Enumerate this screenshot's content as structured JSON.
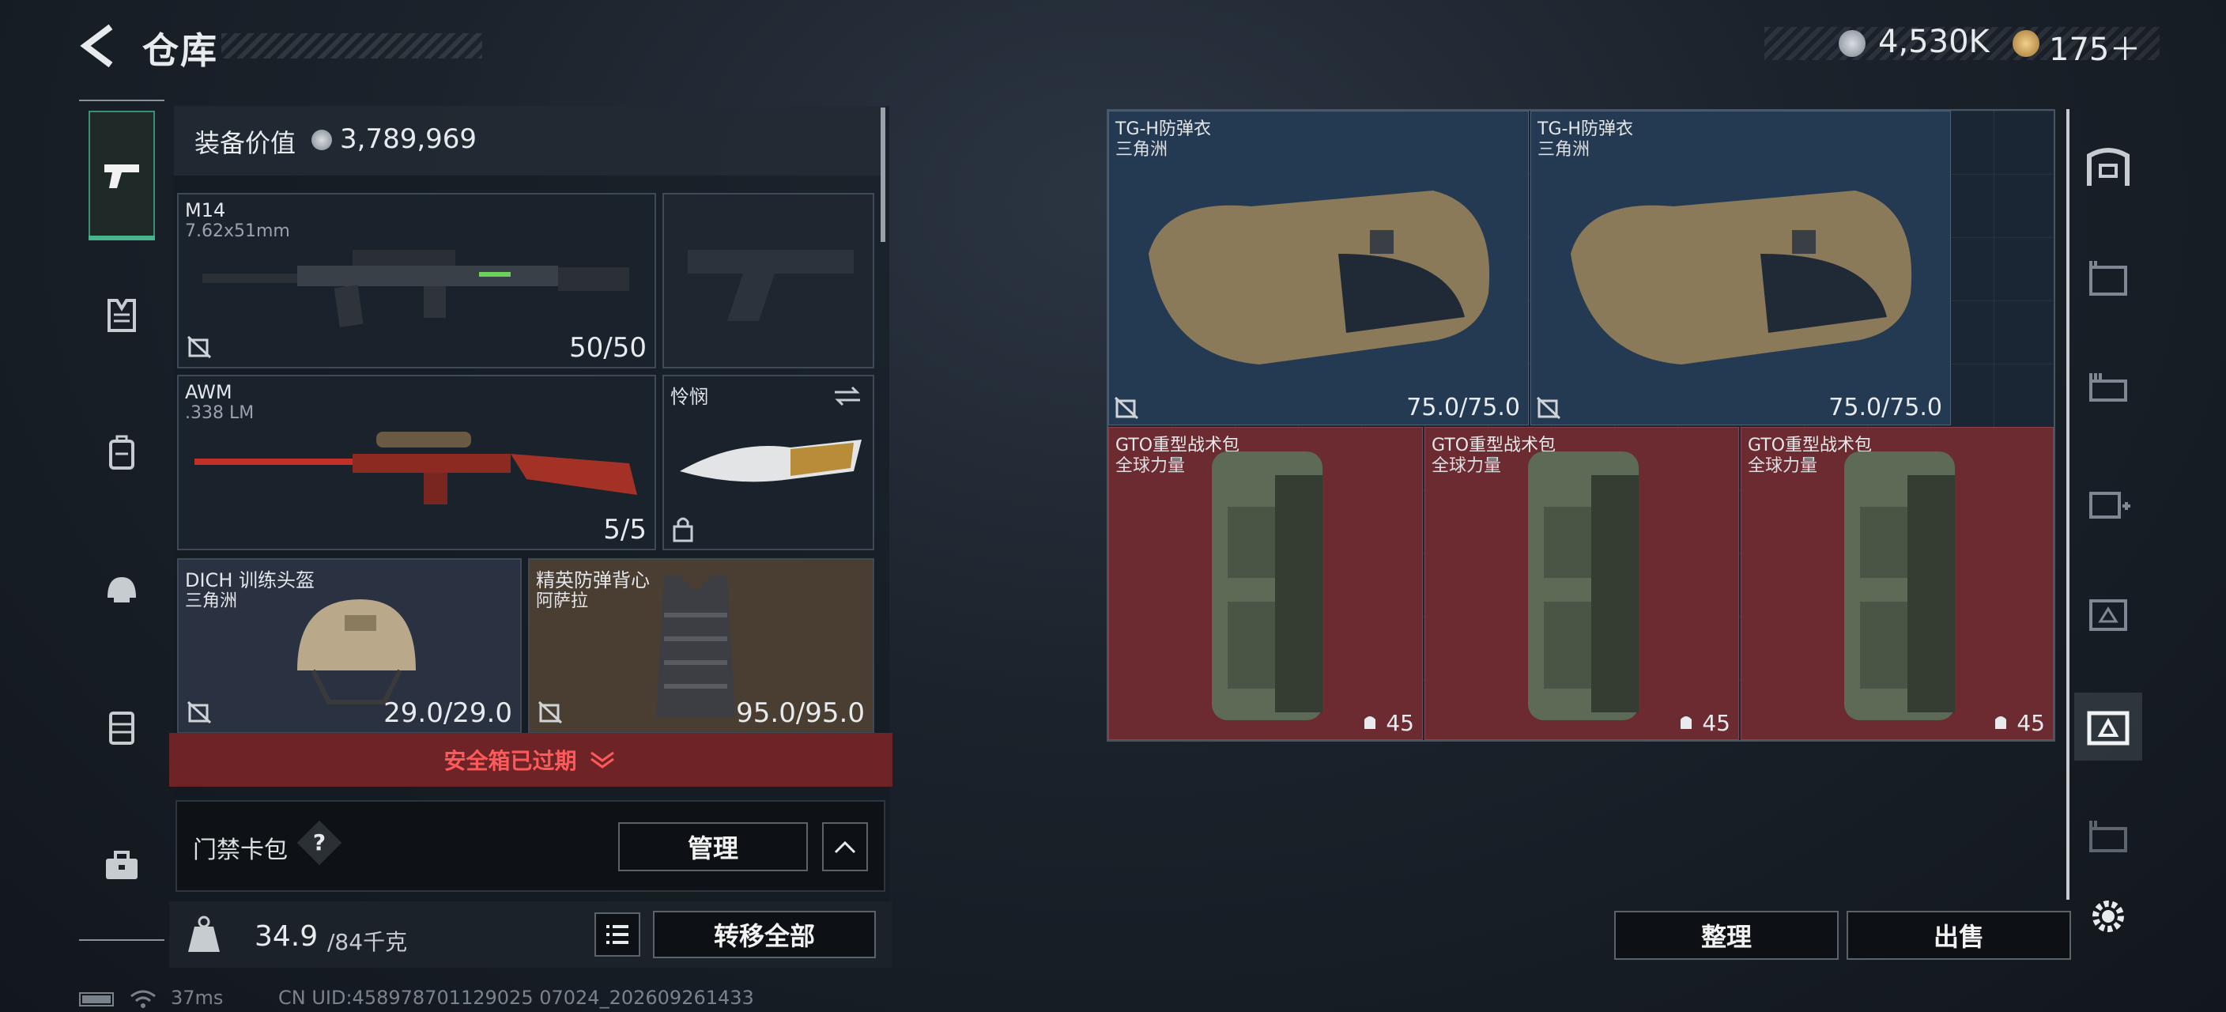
{
  "header": {
    "title": "仓库",
    "currency_1": "4,530K",
    "currency_2": "175＋"
  },
  "side_nav": {
    "items": [
      "pistol-icon",
      "vest-icon",
      "backpack-icon",
      "helmet-icon",
      "chest-rig-icon",
      "toolbox-icon"
    ],
    "active": 0
  },
  "loadout": {
    "value_label": "装备价值",
    "value": "3,789,969",
    "primary": {
      "name": "M14",
      "ammo": "7.62x51mm",
      "durability": "50/50"
    },
    "secondary": {
      "name": "AWM",
      "ammo": ".338 LM",
      "durability": "5/5"
    },
    "melee": {
      "name": "怜悯"
    },
    "helmet": {
      "name": "DICH 训练头盔",
      "origin": "三角洲",
      "durability": "29.0/29.0"
    },
    "armor": {
      "name": "精英防弹背心",
      "origin": "阿萨拉",
      "durability": "95.0/95.0"
    },
    "safe_box_status": "安全箱已过期",
    "keycard": {
      "label": "门禁卡包",
      "help": "?",
      "manage": "管理"
    },
    "weight": {
      "current": "34.9",
      "max": "/84千克"
    },
    "transfer_all": "转移全部"
  },
  "storage": {
    "vests": [
      {
        "name": "TG-H防弹衣",
        "origin": "三角洲",
        "durability": "75.0/75.0"
      },
      {
        "name": "TG-H防弹衣",
        "origin": "三角洲",
        "durability": "75.0/75.0"
      }
    ],
    "bags": [
      {
        "name": "GTO重型战术包",
        "origin": "全球力量",
        "capacity": "45"
      },
      {
        "name": "GTO重型战术包",
        "origin": "全球力量",
        "capacity": "45"
      },
      {
        "name": "GTO重型战术包",
        "origin": "全球力量",
        "capacity": "45"
      }
    ],
    "sort": "整理",
    "sell": "出售"
  },
  "right_nav": [
    "shelf-icon",
    "case-icon-1",
    "case-icon-2",
    "case-icon-3",
    "case-icon-4",
    "case-icon-5",
    "case-icon-6"
  ],
  "status_bar": {
    "ping": "37ms",
    "uid": "CN UID:458978701129025 07024_202609261433"
  },
  "colors": {
    "accent": "#46b58c",
    "danger": "#ff5a5a",
    "bag_bg": "#6b2b31",
    "vest_bg": "#243a52"
  }
}
